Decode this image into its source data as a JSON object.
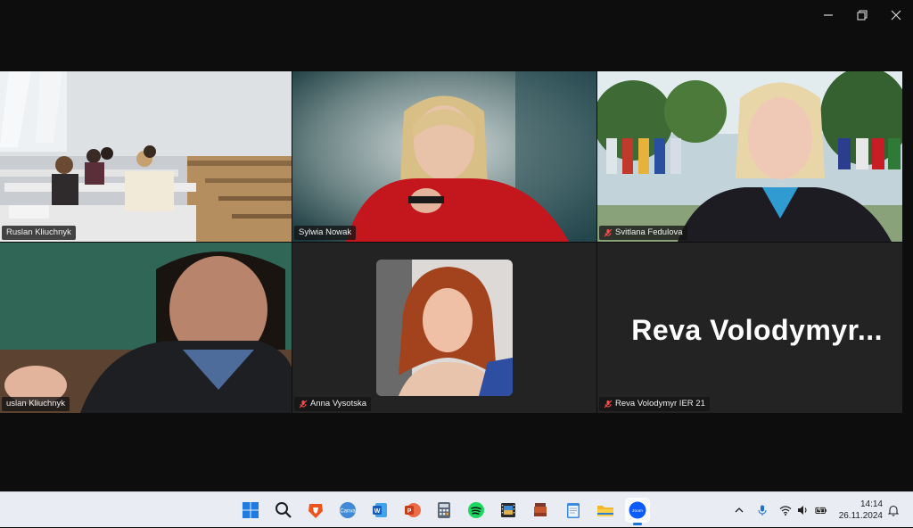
{
  "window": {
    "controls": [
      "minimize-icon",
      "restore-icon",
      "close-icon"
    ]
  },
  "participants": [
    {
      "name": "Ruslan Kliuchnyk",
      "muted": false,
      "scene": "classroom"
    },
    {
      "name": "Sylwia Nowak",
      "muted": false,
      "scene": "red-sweater"
    },
    {
      "name": "Svitlana Fedulova",
      "muted": true,
      "scene": "flags"
    },
    {
      "name": "Ruslan Kliuchnyk",
      "display_name": "uslan Kliuchnyk",
      "muted": false,
      "active_speaker": true,
      "scene": "speaker-chalkboard"
    },
    {
      "name": "Anna Vysotska",
      "muted": true,
      "scene": "portrait"
    },
    {
      "name": "Reva Volodymyr IER 21",
      "muted": true,
      "video_off": true,
      "big_label": "Reva  Volodymyr..."
    }
  ],
  "taskbar": {
    "apps": [
      "windows-start-icon",
      "search-icon",
      "brave-browser-icon",
      "canva-icon",
      "word-icon",
      "powerpoint-icon",
      "calculator-icon",
      "spotify-icon",
      "film-editor-icon",
      "archive-app-icon",
      "notepad-icon",
      "file-explorer-icon",
      "zoom-icon"
    ],
    "active_app": "zoom-icon",
    "zoom_label": "zoom",
    "tray": [
      "chevron-up-icon",
      "microphone-icon",
      "wifi-icon",
      "volume-icon",
      "battery-icon"
    ],
    "time": "14:14",
    "date": "26.11.2024",
    "notification": "bell-icon"
  }
}
